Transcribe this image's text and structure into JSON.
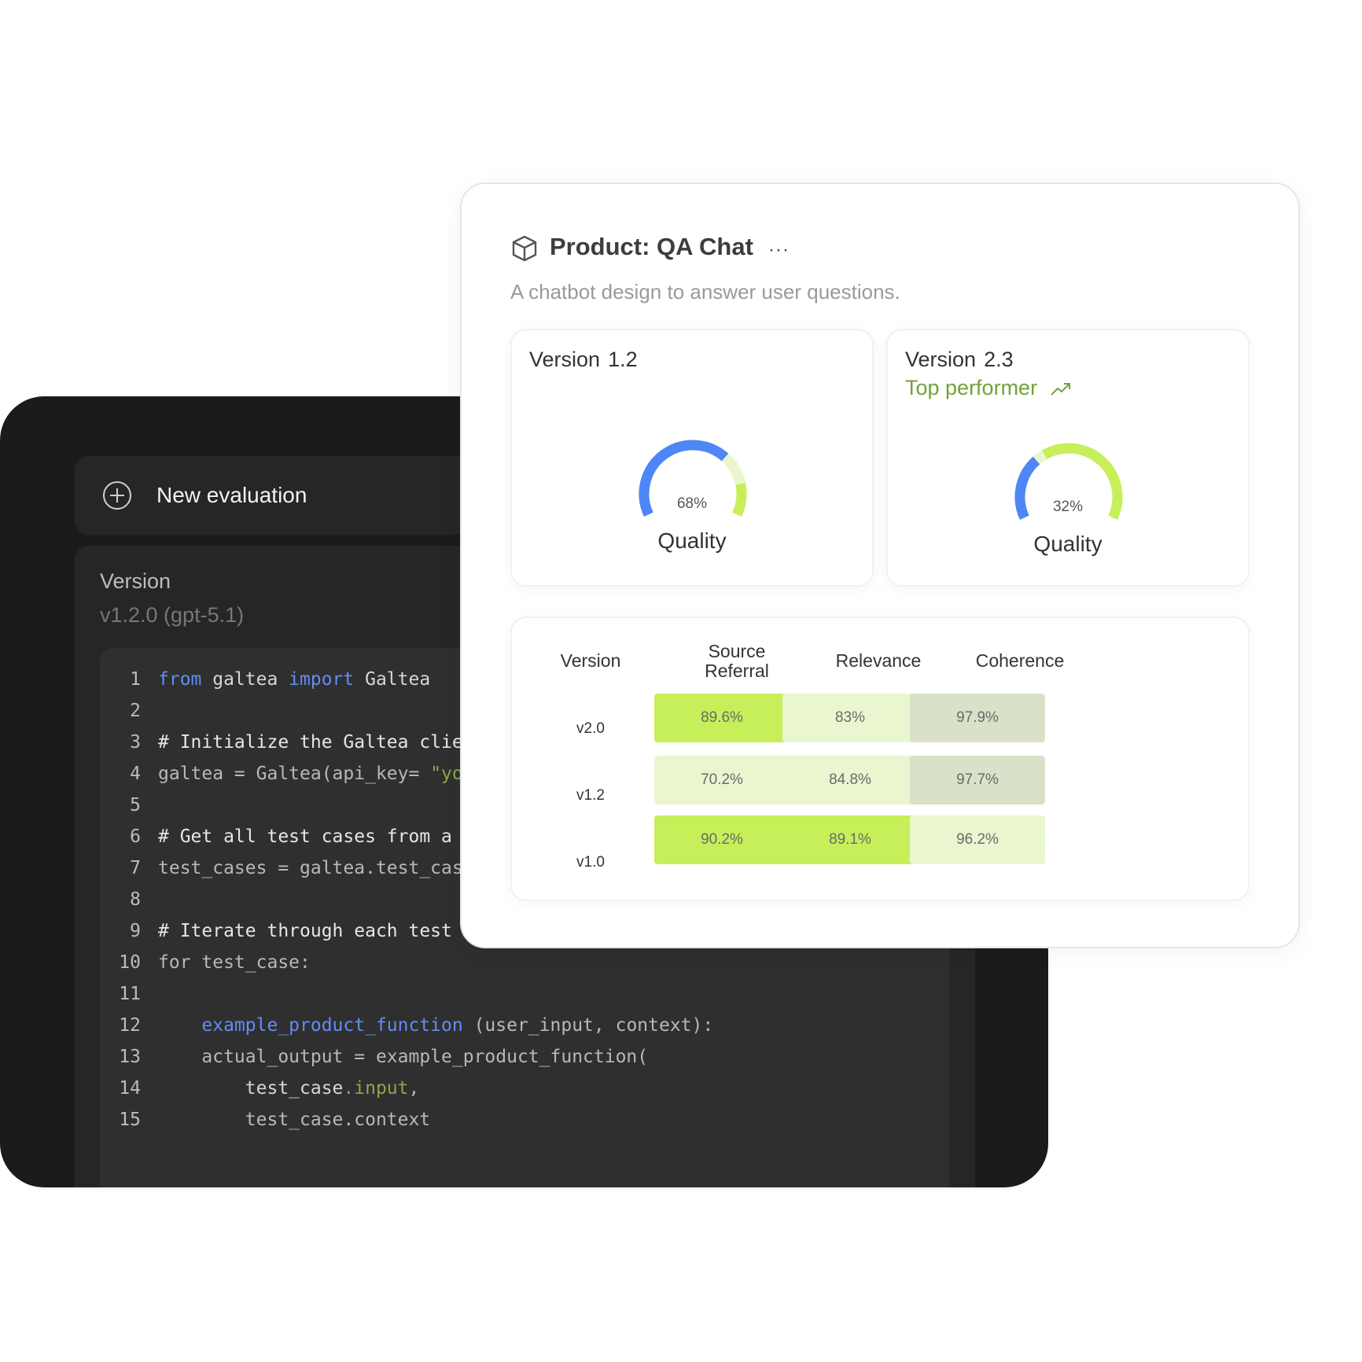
{
  "colors": {
    "dark_bg": "#1b1b1b",
    "keyword": "#5f8df5",
    "string": "#8aa84a",
    "accent_green": "#6fa33a",
    "gauge_blue": "#4f86f7",
    "gauge_lime": "#c6ef59",
    "gauge_track": "#eaf6cf",
    "cell_strong": "#c6ef59",
    "cell_light": "#eaf6cf",
    "cell_gray": "#d9e1c9"
  },
  "dark_panel": {
    "new_eval_label": "New evaluation",
    "version_title": "Version",
    "version_value": "v1.2.0 (gpt-5.1)",
    "code": [
      {
        "n": "1",
        "tokens": [
          [
            "kw",
            "from"
          ],
          [
            "t",
            " galtea "
          ],
          [
            "kw",
            "import"
          ],
          [
            "t",
            " Galtea"
          ]
        ]
      },
      {
        "n": "2",
        "tokens": []
      },
      {
        "n": "3",
        "tokens": [
          [
            "com",
            "# Initialize the Galtea clie"
          ]
        ]
      },
      {
        "n": "4",
        "tokens": [
          [
            "dim",
            "galtea = Galtea(api_key= "
          ],
          [
            "str",
            "\"yo"
          ]
        ]
      },
      {
        "n": "5",
        "tokens": []
      },
      {
        "n": "6",
        "tokens": [
          [
            "com",
            "# Get all test cases from a"
          ]
        ]
      },
      {
        "n": "7",
        "tokens": [
          [
            "dim",
            "test_cases = galtea.test_cas"
          ]
        ]
      },
      {
        "n": "8",
        "tokens": []
      },
      {
        "n": "9",
        "tokens": [
          [
            "com",
            "# Iterate through each test case"
          ]
        ]
      },
      {
        "n": "10",
        "tokens": [
          [
            "dim",
            "for test_case:"
          ]
        ]
      },
      {
        "n": "11",
        "tokens": []
      },
      {
        "n": "12",
        "tokens": [
          [
            "t",
            "    "
          ],
          [
            "fn",
            "example_product_function"
          ],
          [
            "dim",
            " (user_input, context):"
          ]
        ]
      },
      {
        "n": "13",
        "tokens": [
          [
            "dim",
            "    actual_output = example_product_function("
          ]
        ]
      },
      {
        "n": "14",
        "tokens": [
          [
            "t",
            "        test_case"
          ],
          [
            "attr",
            ".input"
          ],
          [
            "dim",
            ","
          ]
        ]
      },
      {
        "n": "15",
        "tokens": [
          [
            "dim",
            "        test_case.context"
          ]
        ]
      }
    ]
  },
  "product": {
    "title": "Product: QA Chat",
    "more": "···",
    "description": "A chatbot design to answer user questions.",
    "versions": [
      {
        "label": "Version",
        "number": "1.2",
        "badge": "",
        "quality_pct": 68,
        "quality_text": "68%",
        "quality_label": "Quality"
      },
      {
        "label": "Version",
        "number": "2.3",
        "badge": "Top performer",
        "quality_pct": 32,
        "quality_text": "32%",
        "quality_label": "Quality"
      }
    ],
    "metrics": {
      "headers": [
        "Version",
        "Source\nReferral",
        "Relevance",
        "Coherence"
      ],
      "rows": [
        {
          "version": "v2.0",
          "values": [
            "89.6%",
            "83%",
            "97.9%"
          ],
          "shade": [
            "strong",
            "light",
            "gray"
          ]
        },
        {
          "version": "v1.2",
          "values": [
            "70.2%",
            "84.8%",
            "97.7%"
          ],
          "shade": [
            "light",
            "light",
            "gray"
          ]
        },
        {
          "version": "v1.0",
          "values": [
            "90.2%",
            "89.1%",
            "96.2%"
          ],
          "shade": [
            "strong",
            "strong",
            "light"
          ]
        }
      ]
    }
  }
}
